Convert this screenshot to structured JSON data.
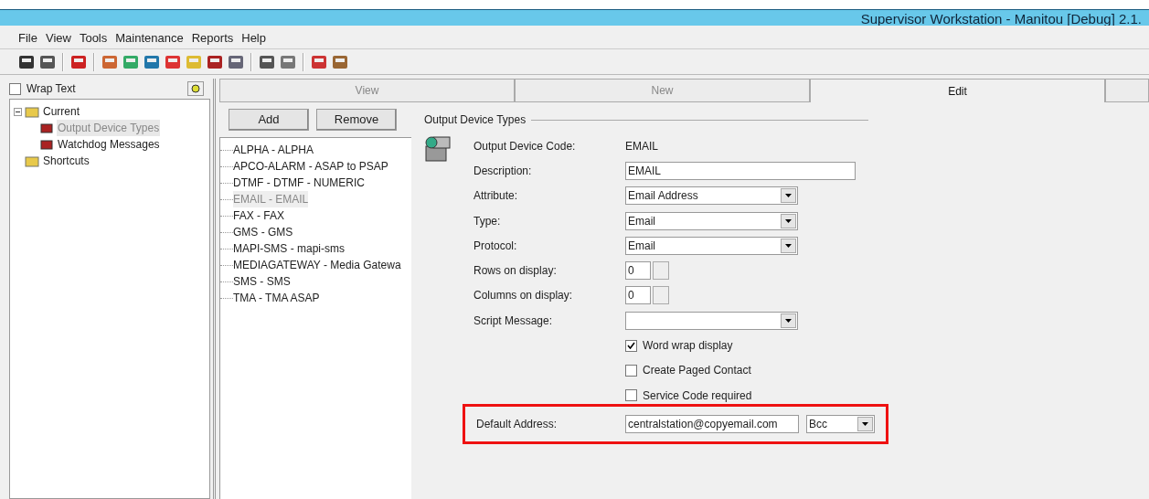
{
  "window": {
    "title": "Supervisor Workstation - Manitou [Debug] 2.1."
  },
  "menu": [
    "File",
    "View",
    "Tools",
    "Maintenance",
    "Reports",
    "Help"
  ],
  "left_panel": {
    "wrap_text": {
      "label": "Wrap Text",
      "checked": false
    },
    "tree": [
      {
        "label": "Current",
        "expanded": true,
        "selected": false,
        "children": [
          {
            "label": "Output Device Types",
            "selected": true
          },
          {
            "label": "Watchdog Messages",
            "selected": false
          }
        ]
      },
      {
        "label": "Shortcuts",
        "selected": false
      }
    ]
  },
  "tabs": [
    {
      "label": "View",
      "selected": false
    },
    {
      "label": "New",
      "selected": false
    },
    {
      "label": "Edit",
      "selected": true
    }
  ],
  "list_panel": {
    "buttons": [
      "Add",
      "Remove"
    ],
    "items": [
      {
        "label": "ALPHA - ALPHA",
        "selected": false
      },
      {
        "label": "APCO-ALARM - ASAP to PSAP",
        "selected": false
      },
      {
        "label": "DTMF - DTMF - NUMERIC",
        "selected": false
      },
      {
        "label": "EMAIL - EMAIL",
        "selected": true
      },
      {
        "label": "FAX - FAX",
        "selected": false
      },
      {
        "label": "GMS - GMS",
        "selected": false
      },
      {
        "label": "MAPI-SMS - mapi-sms",
        "selected": false
      },
      {
        "label": "MEDIAGATEWAY - Media Gatewa",
        "selected": false
      },
      {
        "label": "SMS - SMS",
        "selected": false
      },
      {
        "label": "TMA - TMA ASAP",
        "selected": false
      }
    ]
  },
  "form": {
    "group_title": "Output Device Types",
    "fields": [
      {
        "kind": "static",
        "label": "Output Device Code:",
        "value": "EMAIL"
      },
      {
        "kind": "text",
        "label": "Description:",
        "value": "EMAIL"
      },
      {
        "kind": "select",
        "label": "Attribute:",
        "value": "Email Address"
      },
      {
        "kind": "select",
        "label": "Type:",
        "value": "Email"
      },
      {
        "kind": "select",
        "label": "Protocol:",
        "value": "Email"
      },
      {
        "kind": "spin",
        "label": "Rows on display:",
        "value": "0"
      },
      {
        "kind": "spin",
        "label": "Columns on display:",
        "value": "0"
      },
      {
        "kind": "select",
        "label": "Script Message:"
      }
    ],
    "checkboxes": [
      {
        "label": "Word wrap display",
        "checked": true
      },
      {
        "label": "Create Paged Contact",
        "checked": false
      },
      {
        "label": "Service Code required",
        "checked": false
      }
    ],
    "default_address": {
      "label": "Default Address:",
      "value": "centralstation@copyemail.com",
      "mode": "Bcc",
      "highlighted": true
    }
  }
}
